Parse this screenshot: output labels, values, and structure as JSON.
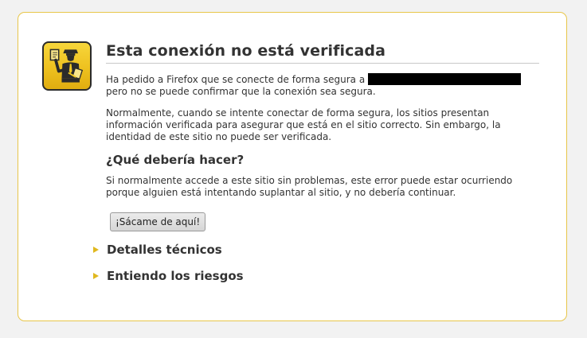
{
  "error_page": {
    "title": "Esta conexión no está verificada",
    "intro_text": "Ha pedido a Firefox que se conecte de forma segura a",
    "intro_text_2": "pero no se puede confirmar que la conexión sea segura.",
    "explanation": "Normalmente, cuando se intente conectar de forma segura, los sitios presentan información verificada para asegurar que está en el sitio correcto. Sin embargo, la identidad de este sitio no puede ser verificada.",
    "what_heading": "¿Qué debería hacer?",
    "what_text": "Si normalmente accede a este sitio sin problemas, este error puede estar ocurriendo porque alguien está intentando suplantar al sitio, y no debería continuar.",
    "get_me_out_label": "¡Sácame de aquí!",
    "technical_details_label": "Detalles técnicos",
    "understand_risks_label": "Entiendo los riesgos",
    "icon": "security-officer-icon"
  },
  "colors": {
    "border": "#e8c64a",
    "icon_yellow": "#f2c922",
    "arrow": "#e0b81f",
    "text": "#333333"
  }
}
